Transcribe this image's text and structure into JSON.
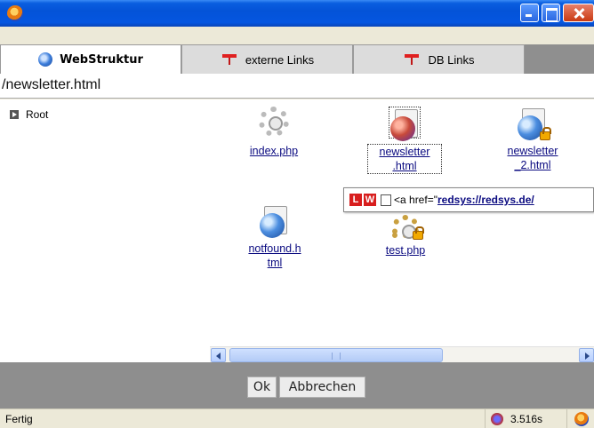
{
  "window": {
    "title": ""
  },
  "tabs": [
    {
      "label": "WebStruktur",
      "icon": "globe-page-icon",
      "active": true
    },
    {
      "label": "externe Links",
      "icon": "link-icon",
      "active": false
    },
    {
      "label": "DB Links",
      "icon": "link-icon",
      "active": false
    }
  ],
  "path": "/newsletter.html",
  "tree": {
    "root_label": "Root"
  },
  "files": [
    {
      "name": "index.php",
      "icon": "gear-icon"
    },
    {
      "name": "newsletter.html",
      "line1": "newsletter",
      "line2": ".html",
      "icon": "globe-document-icon",
      "selected": true
    },
    {
      "name": "newsletter_2.html",
      "line1": "newsletter",
      "line2": "_2.html",
      "icon": "locked-globe-document-icon"
    },
    {
      "name": "notfound.html",
      "line1": "notfound.h",
      "line2": "tml",
      "icon": "globe-document-icon"
    },
    {
      "name": "test.php",
      "icon": "locked-gear-icon"
    }
  ],
  "tooltip": {
    "badge_l": "L",
    "badge_w": "W",
    "prefix": "<a href=\"",
    "link": "redsys://redsys.de/"
  },
  "buttons": {
    "ok": "Ok",
    "cancel": "Abbrechen"
  },
  "status": {
    "text": "Fertig",
    "timer": "3.516s"
  },
  "colors": {
    "titlebar": "#0453d8",
    "link": "#0a0a80",
    "button_area": "#8e8e8e",
    "badge_red": "#d81e1e"
  }
}
